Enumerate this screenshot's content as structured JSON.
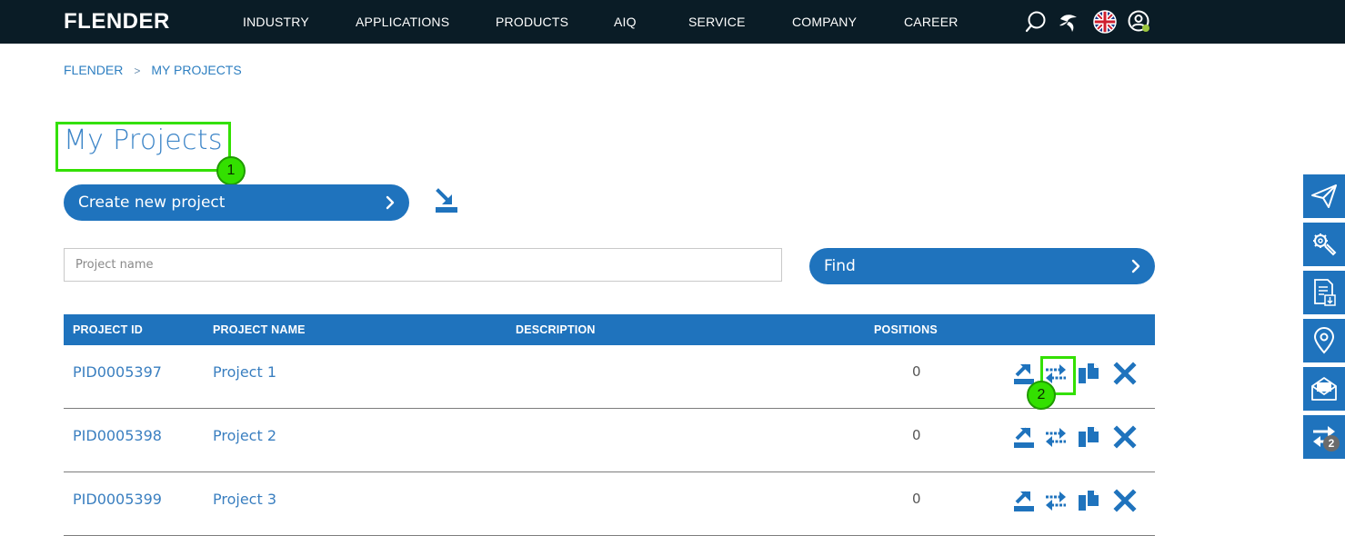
{
  "header": {
    "logo": "FLENDER",
    "nav": [
      "INDUSTRY",
      "APPLICATIONS",
      "PRODUCTS",
      "AIQ",
      "SERVICE",
      "COMPANY",
      "CAREER"
    ],
    "icons": [
      "search-icon",
      "fan-icon",
      "uk-flag-icon",
      "user-account-icon"
    ]
  },
  "breadcrumb": {
    "home": "FLENDER",
    "separator": ">",
    "current": "MY PROJECTS"
  },
  "page": {
    "title": "My Projects"
  },
  "annotations": {
    "one": "1",
    "two": "2"
  },
  "actions": {
    "create_label": "Create new project",
    "find_label": "Find",
    "import_icon": "import-icon"
  },
  "search": {
    "placeholder": "Project name",
    "value": ""
  },
  "table": {
    "headers": {
      "id": "PROJECT ID",
      "name": "PROJECT NAME",
      "description": "DESCRIPTION",
      "positions": "POSITIONS"
    },
    "rows": [
      {
        "id": "PID0005397",
        "name": "Project 1",
        "description": "",
        "positions": "0"
      },
      {
        "id": "PID0005398",
        "name": "Project 2",
        "description": "",
        "positions": "0"
      },
      {
        "id": "PID0005399",
        "name": "Project 3",
        "description": "",
        "positions": "0"
      }
    ],
    "row_actions": [
      "export-icon",
      "compare-icon",
      "copy-icon",
      "delete-icon"
    ]
  },
  "rail": {
    "items": [
      "send-icon",
      "tools-icon",
      "document-download-icon",
      "location-icon",
      "quote-icon",
      "compare-icon"
    ],
    "compare_count": "2"
  },
  "colors": {
    "brand": "#1f73bd",
    "nav_bg": "#0a1c26",
    "annotation": "#33e000",
    "text_link": "#3a7fc0"
  }
}
